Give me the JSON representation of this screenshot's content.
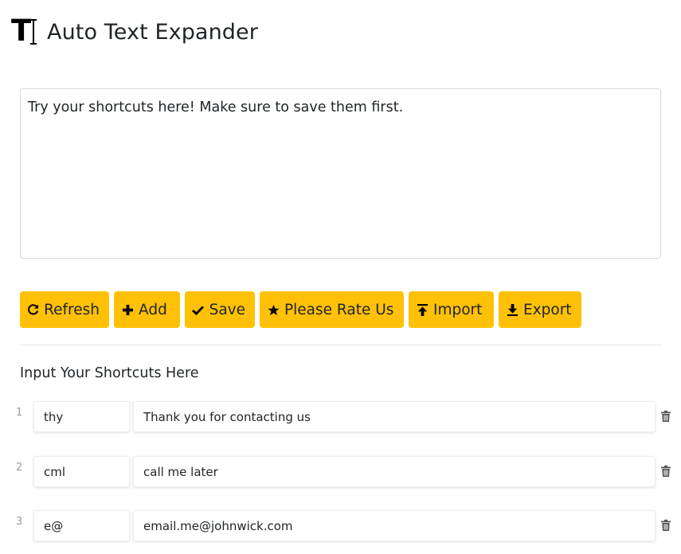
{
  "header": {
    "logo_icon": "text-cursor-logo-icon",
    "title": "Auto Text Expander"
  },
  "try_area": {
    "placeholder": "Try your shortcuts here! Make sure to save them first."
  },
  "toolbar": {
    "accent_color": "#ffc107",
    "refresh": {
      "icon": "refresh-icon",
      "label": "Refresh"
    },
    "add": {
      "icon": "plus-icon",
      "label": "Add"
    },
    "save": {
      "icon": "check-icon",
      "label": "Save"
    },
    "rate": {
      "icon": "star-icon",
      "label": "Please Rate Us"
    },
    "import": {
      "icon": "upload-icon",
      "label": "Import"
    },
    "export": {
      "icon": "download-icon",
      "label": "Export"
    }
  },
  "shortcuts_section": {
    "label": "Input Your Shortcuts Here"
  },
  "shortcuts": [
    {
      "number": "1",
      "key": "thy",
      "value": "Thank you for contacting us",
      "delete_icon": "trash-icon"
    },
    {
      "number": "2",
      "key": "cml",
      "value": "call me later",
      "delete_icon": "trash-icon"
    },
    {
      "number": "3",
      "key": "e@",
      "value": "email.me@johnwick.com",
      "delete_icon": "trash-icon"
    }
  ]
}
